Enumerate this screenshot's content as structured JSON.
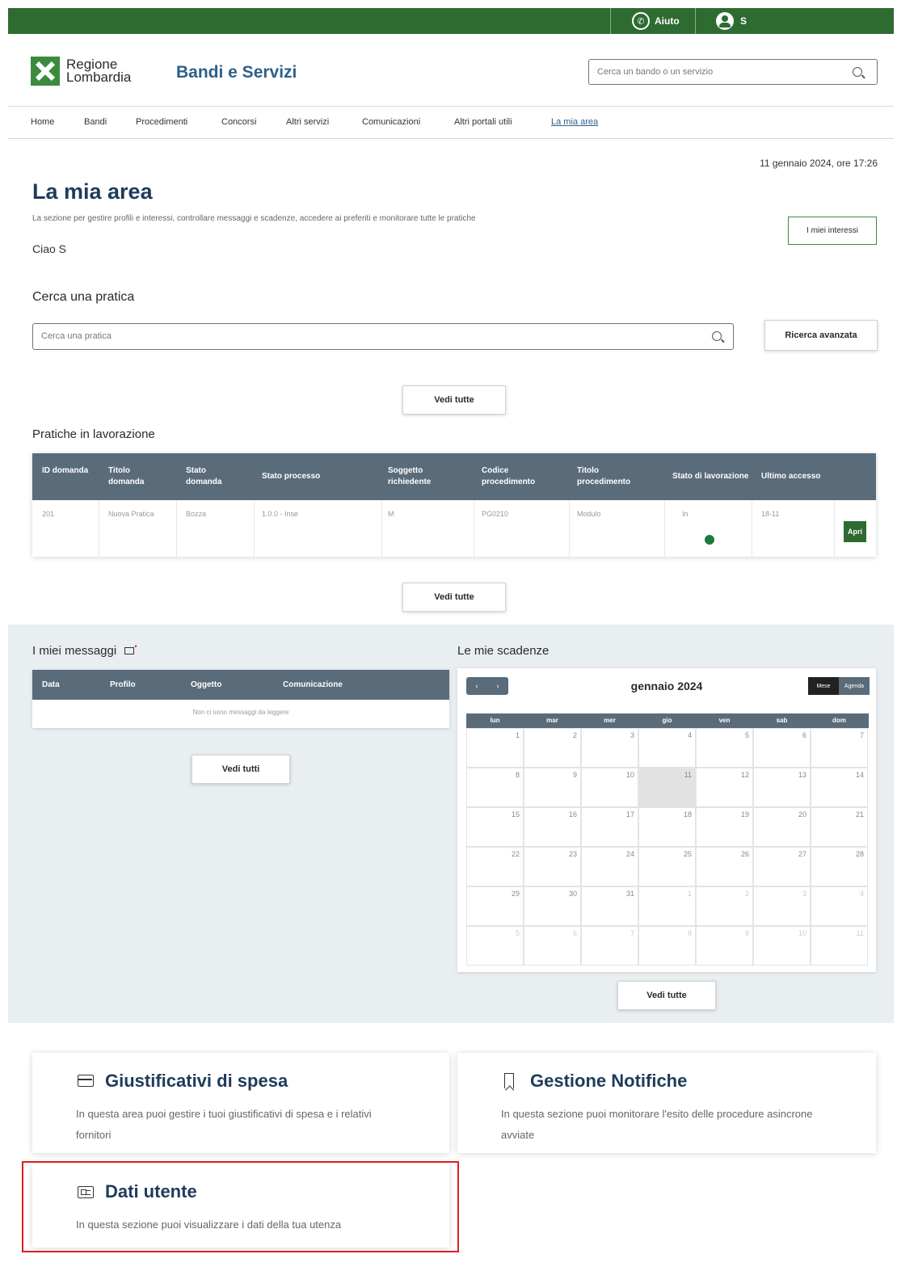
{
  "topbar": {
    "help_label": "Aiuto",
    "user_label": "S"
  },
  "header": {
    "logo_line1": "Regione",
    "logo_line2": "Lombardia",
    "site_title": "Bandi e Servizi",
    "search_placeholder": "Cerca un bando o un servizio"
  },
  "nav": {
    "items": [
      "Home",
      "Bandi",
      "Procedimenti",
      "Concorsi",
      "Altri servizi",
      "Comunicazioni",
      "Altri portali utili",
      "La mia area"
    ]
  },
  "main": {
    "date": "11 gennaio 2024, ore 17:26",
    "title": "La mia area",
    "intro": "La sezione per gestire profili e interessi, controllare messaggi e scadenze, accedere ai preferiti e monitorare tutte le pratiche",
    "greeting": "Ciao S",
    "interests_button": "I miei interessi"
  },
  "search": {
    "heading": "Cerca una pratica",
    "placeholder": "Cerca una pratica",
    "advanced_button": "Ricerca avanzata",
    "view_all": "Vedi tutte"
  },
  "pratiche": {
    "heading": "Pratiche in lavorazione",
    "columns": [
      "ID domanda",
      "Titolo domanda",
      "Stato domanda",
      "Stato processo",
      "Soggetto richiedente",
      "Codice procedimento",
      "Titolo procedimento",
      "Stato di lavorazione",
      "Ultimo accesso"
    ],
    "row": [
      "201",
      "Nuova Pratica",
      "Bozza",
      "1.0.0 - Inse",
      "M",
      "PG0210",
      "Modulo",
      "In",
      "18-11"
    ],
    "open_button": "Apri",
    "view_all": "Vedi tutte"
  },
  "messages": {
    "heading": "I miei messaggi",
    "columns": [
      "Data",
      "Profilo",
      "Oggetto",
      "Comunicazione"
    ],
    "empty": "Non ci sono messaggi da leggere",
    "view_all": "Vedi tutti"
  },
  "deadlines": {
    "heading": "Le mie scadenze",
    "month": "gennaio 2024",
    "nav": [
      "‹",
      "›"
    ],
    "views": [
      "Mese",
      "Agenda"
    ],
    "weekdays": [
      "lun",
      "mar",
      "mer",
      "gio",
      "ven",
      "sab",
      "dom"
    ],
    "days": [
      [
        "1",
        "2",
        "3",
        "4",
        "5",
        "6",
        "7"
      ],
      [
        "8",
        "9",
        "10",
        "11",
        "12",
        "13",
        "14"
      ],
      [
        "15",
        "16",
        "17",
        "18",
        "19",
        "20",
        "21"
      ],
      [
        "22",
        "23",
        "24",
        "25",
        "26",
        "27",
        "28"
      ],
      [
        "29",
        "30",
        "31",
        "1",
        "2",
        "3",
        "4"
      ],
      [
        "5",
        "6",
        "7",
        "8",
        "9",
        "10",
        "11"
      ]
    ],
    "view_all": "Vedi tutte"
  },
  "cards": {
    "giustificativi": {
      "title": "Giustificativi di spesa",
      "desc": "In questa area puoi gestire i tuoi giustificativi di spesa e i relativi fornitori"
    },
    "notifiche": {
      "title": "Gestione Notifiche",
      "desc": "In questa sezione puoi monitorare l'esito delle procedure asincrone avviate"
    },
    "dati": {
      "title": "Dati utente",
      "desc": "In questa sezione puoi visualizzare i dati della tua utenza"
    }
  },
  "colors": {
    "green": "#2e6b31",
    "header_gray": "#5a6b7a",
    "band": "#e9eef1",
    "highlight": "#e31b23"
  }
}
